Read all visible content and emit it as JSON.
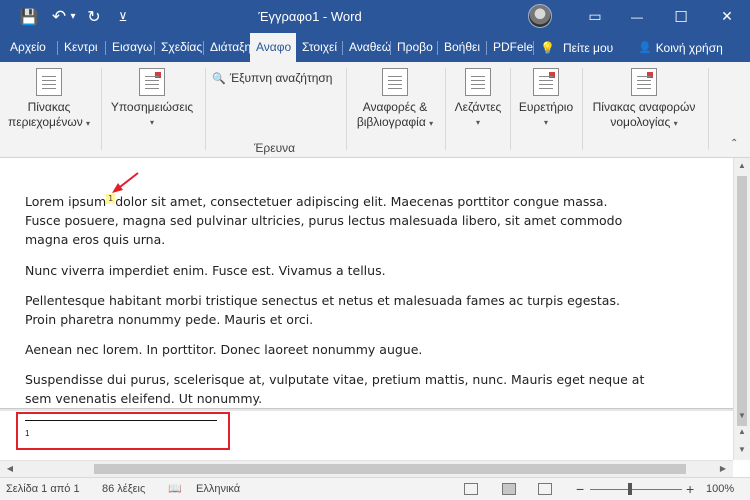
{
  "titlebar": {
    "title": "Έγγραφο1 - Word",
    "save_icon": "💾",
    "undo_icon": "↶",
    "undo_dropdown": "▾",
    "redo_icon": "↻",
    "customize_icon": "⊻",
    "ribbon_options_icon": "▭",
    "minimize_icon": "—",
    "maximize_icon": "☐",
    "close_icon": "✕"
  },
  "tabs": {
    "items": [
      {
        "label": "Αρχείο"
      },
      {
        "label": "Κεντρι"
      },
      {
        "label": "Εισαγω"
      },
      {
        "label": "Σχεδίας"
      },
      {
        "label": "Διάταξη"
      },
      {
        "label": "Αναφο",
        "active": true
      },
      {
        "label": "Στοιχεί"
      },
      {
        "label": "Αναθεώ"
      },
      {
        "label": "Προβο"
      },
      {
        "label": "Βοήθει"
      },
      {
        "label": "PDFelei"
      }
    ],
    "tell_me_icon": "💡",
    "tell_me": "Πείτε μου",
    "share_icon": "👤",
    "share": "Κοινή χρήση"
  },
  "ribbon": {
    "toc_line1": "Πίνακας",
    "toc_line2": "περιεχομένων",
    "footnotes": "Υποσημειώσεις",
    "smart_lookup_icon": "🔍",
    "smart_lookup": "Έξυπνη αναζήτηση",
    "research_group": "Έρευνα",
    "citations_line1": "Αναφορές &",
    "citations_line2": "βιβλιογραφία",
    "captions": "Λεζάντες",
    "index": "Ευρετήριο",
    "authorities_line1": "Πίνακας αναφορών",
    "authorities_line2": "νομολογίας",
    "dropdown_caret": "▾"
  },
  "document": {
    "p1_before": "Lorem ipsum",
    "p1_ref": "1",
    "p1_after": "dolor sit amet, consectetuer adipiscing elit. Maecenas porttitor congue massa. Fusce posuere, magna sed pulvinar ultricies, purus lectus malesuada libero, sit amet commodo magna eros quis urna.",
    "p2": "Nunc viverra imperdiet enim. Fusce est. Vivamus a tellus.",
    "p3": "Pellentesque habitant morbi tristique senectus et netus et malesuada fames ac turpis egestas. Proin pharetra nonummy pede. Mauris et orci.",
    "p4": "Aenean nec lorem. In porttitor. Donec laoreet nonummy augue.",
    "p5": "Suspendisse dui purus, scelerisque at, vulputate vitae, pretium mattis, nunc. Mauris eget neque at sem venenatis eleifend. Ut nonummy."
  },
  "footnote_pane": {
    "number": "1"
  },
  "scroll": {
    "up": "▲",
    "down": "▼",
    "left": "◀",
    "right": "▶"
  },
  "statusbar": {
    "page": "Σελίδα 1 από 1",
    "words": "86 λέξεις",
    "proofing_icon": "📖",
    "language": "Ελληνικά",
    "zoom_out": "−",
    "zoom_in": "+",
    "zoom": "100%"
  },
  "colors": {
    "word_blue": "#2b579a",
    "highlight_red": "#e0202a",
    "footnote_ref_bg": "#fff79a"
  }
}
